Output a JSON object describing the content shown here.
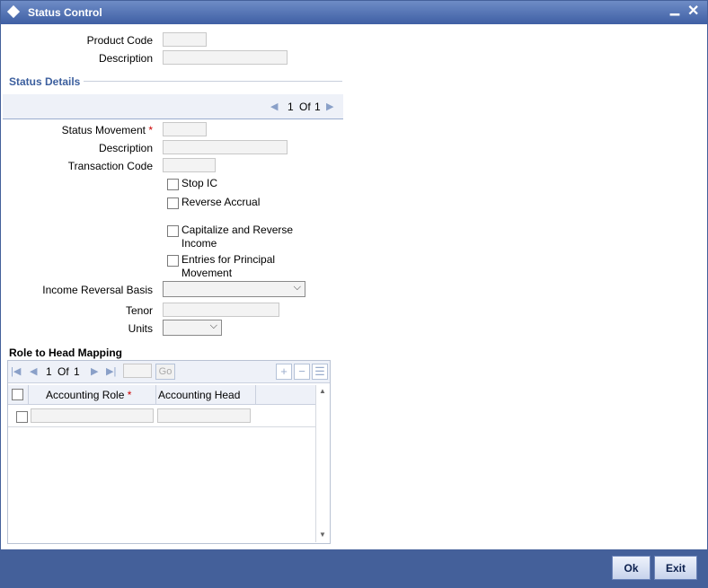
{
  "window": {
    "title": "Status Control",
    "minimize": "▁",
    "close": "✕"
  },
  "header": {
    "product_code_label": "Product Code",
    "description_label": "Description"
  },
  "status_details": {
    "section_title": "Status Details",
    "pager": {
      "current": "1",
      "of": "Of",
      "total": "1"
    },
    "status_movement_label": "Status Movement",
    "required_mark": "*",
    "description_label": "Description",
    "transaction_code_label": "Transaction Code",
    "stop_ic_label": "Stop IC",
    "reverse_accrual_label": "Reverse Accrual",
    "capitalize_line1": "Capitalize and Reverse",
    "capitalize_line2": "Income",
    "entries_line1": "Entries for Principal",
    "entries_line2": "Movement",
    "income_reversal_basis_label": "Income Reversal Basis",
    "tenor_label": "Tenor",
    "units_label": "Units"
  },
  "role_head_mapping": {
    "title": "Role to Head Mapping",
    "pager": {
      "current": "1",
      "of": "Of",
      "total": "1"
    },
    "go_label": "Go",
    "add_label": "+",
    "delete_label": "−",
    "columns": [
      "Accounting Role",
      "Accounting Head"
    ],
    "required_mark": "*"
  },
  "footer": {
    "ok_label": "Ok",
    "exit_label": "Exit"
  }
}
